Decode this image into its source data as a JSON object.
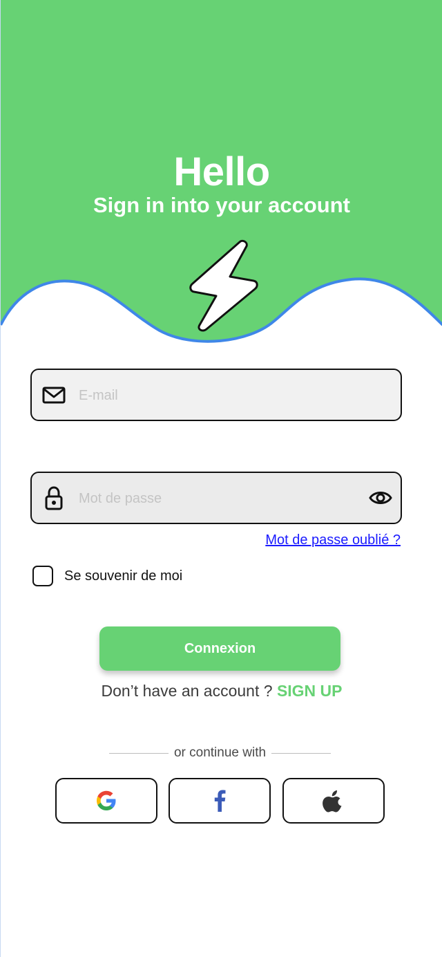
{
  "header": {
    "title": "Hello",
    "subtitle": "Sign in into your account"
  },
  "form": {
    "email": {
      "value": "",
      "placeholder": "E-mail",
      "icon": "mail-icon"
    },
    "password": {
      "value": "",
      "placeholder": "Mot de passe",
      "icon": "lock-icon",
      "toggle_icon": "eye-icon"
    },
    "forgot_label": "Mot de passe oublié ?",
    "remember_label": "Se souvenir de moi",
    "remember_checked": false,
    "submit_label": "Connexion"
  },
  "signup": {
    "prompt": "Don’t have an account ? ",
    "link_label": "SIGN UP"
  },
  "social": {
    "divider_label": "or continue with",
    "providers": [
      "google",
      "facebook",
      "apple"
    ]
  },
  "colors": {
    "brand_green": "#67d274",
    "wave_outline": "#3f87e8",
    "link_blue": "#1a1aff",
    "facebook_blue": "#3b5bb8"
  }
}
